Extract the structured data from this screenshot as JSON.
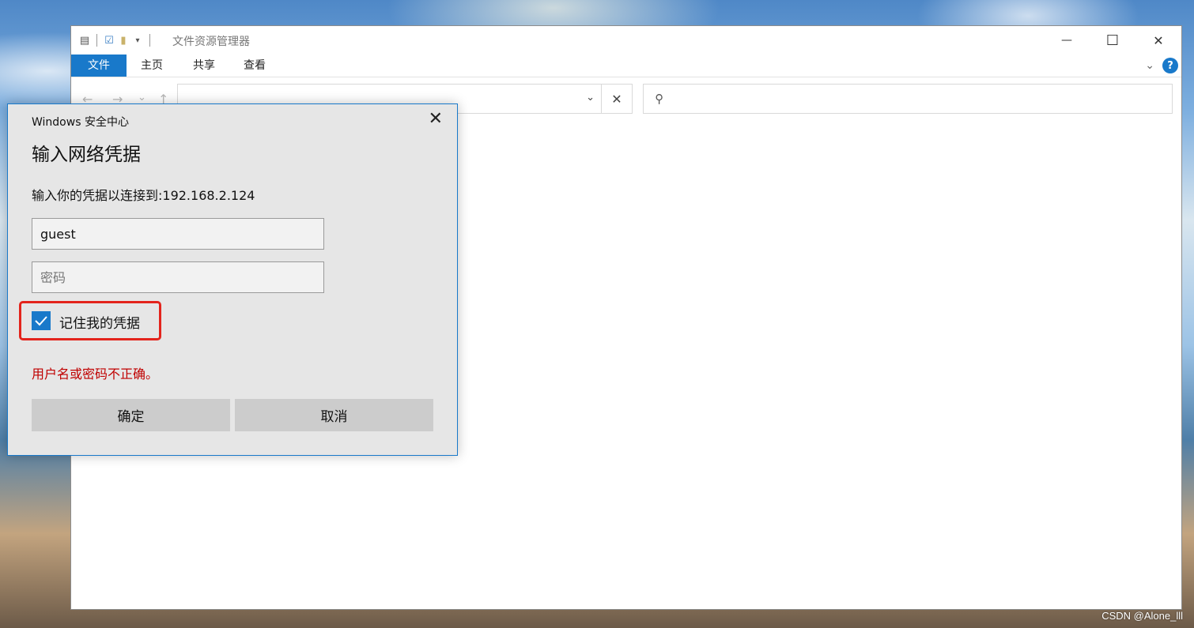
{
  "explorer": {
    "title": "文件资源管理器",
    "quick_access": {
      "props_icon": "properties-icon",
      "check_icon": "check-icon",
      "folder_icon": "new-folder-icon",
      "dropdown_icon": "dropdown-arrow-icon"
    },
    "window_controls": {
      "minimize": "—",
      "maximize": "☐",
      "close": "✕"
    },
    "ribbon_tabs": [
      "文件",
      "主页",
      "共享",
      "查看"
    ],
    "nav": {
      "back": "←",
      "forward": "→",
      "recent": "⌄",
      "up": "↑"
    },
    "address_value": "",
    "accent_color": "#1979ca"
  },
  "dialog": {
    "app_name": "Windows 安全中心",
    "heading": "输入网络凭据",
    "prompt": "输入你的凭据以连接到:192.168.2.124",
    "username_value": "guest",
    "password_placeholder": "密码",
    "remember_label": "记住我的凭据",
    "remember_checked": true,
    "error": "用户名或密码不正确。",
    "ok_label": "确定",
    "cancel_label": "取消",
    "error_color": "#c00000"
  },
  "watermark": "CSDN @Alone_lll"
}
